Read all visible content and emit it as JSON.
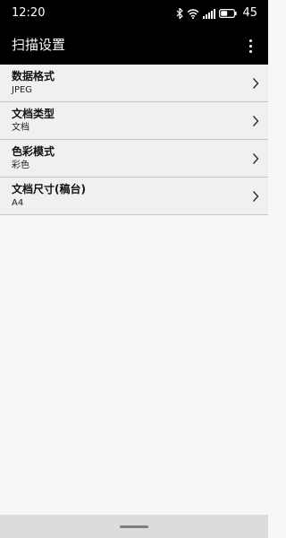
{
  "status_bar": {
    "time": "12:20",
    "battery_level": "45",
    "icons": [
      "bluetooth-icon",
      "wifi-icon",
      "signal-icon",
      "battery-icon"
    ]
  },
  "app_bar": {
    "title": "扫描设置",
    "menu_icon": "more-vertical-icon"
  },
  "settings": [
    {
      "title": "数据格式",
      "value": "JPEG"
    },
    {
      "title": "文档类型",
      "value": "文档"
    },
    {
      "title": "色彩模式",
      "value": "彩色"
    },
    {
      "title": "文档尺寸(稿台)",
      "value": "A4"
    }
  ],
  "colors": {
    "header_bg": "#000000",
    "list_bg": "#f0f0f0",
    "page_bg": "#f7f7f7",
    "divider": "#c6c6c6",
    "nav_bar_bg": "#dcdcdc"
  }
}
